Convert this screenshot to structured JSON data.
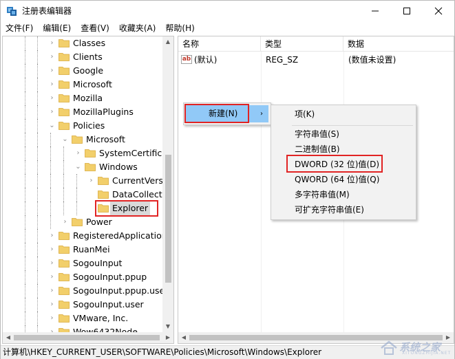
{
  "window": {
    "title": "注册表编辑器"
  },
  "menu": [
    {
      "label": "文件(F)"
    },
    {
      "label": "编辑(E)"
    },
    {
      "label": "查看(V)"
    },
    {
      "label": "收藏夹(A)"
    },
    {
      "label": "帮助(H)"
    }
  ],
  "tree": {
    "items": [
      {
        "label": "Classes",
        "level": 0,
        "expanded": false
      },
      {
        "label": "Clients",
        "level": 0,
        "expanded": false
      },
      {
        "label": "Google",
        "level": 0,
        "expanded": false
      },
      {
        "label": "Microsoft",
        "level": 0,
        "expanded": false
      },
      {
        "label": "Mozilla",
        "level": 0,
        "expanded": false
      },
      {
        "label": "MozillaPlugins",
        "level": 0,
        "expanded": false
      },
      {
        "label": "Policies",
        "level": 0,
        "expanded": true
      },
      {
        "label": "Microsoft",
        "level": 1,
        "expanded": true
      },
      {
        "label": "SystemCertificat",
        "level": 2,
        "expanded": false
      },
      {
        "label": "Windows",
        "level": 2,
        "expanded": true
      },
      {
        "label": "CurrentVersi",
        "level": 3,
        "expanded": false
      },
      {
        "label": "DataCollectio",
        "level": 3,
        "expanded": null
      },
      {
        "label": "Explorer",
        "level": 3,
        "expanded": null,
        "selected": true
      },
      {
        "label": "Power",
        "level": 1,
        "expanded": false
      },
      {
        "label": "RegisteredApplications",
        "level": 0,
        "expanded": false
      },
      {
        "label": "RuanMei",
        "level": 0,
        "expanded": false
      },
      {
        "label": "SogouInput",
        "level": 0,
        "expanded": false
      },
      {
        "label": "SogouInput.ppup",
        "level": 0,
        "expanded": false
      },
      {
        "label": "SogouInput.ppup.user",
        "level": 0,
        "expanded": false
      },
      {
        "label": "SogouInput.user",
        "level": 0,
        "expanded": false
      },
      {
        "label": "VMware, Inc.",
        "level": 0,
        "expanded": false
      },
      {
        "label": "Wow6432Node",
        "level": 0,
        "expanded": false
      }
    ]
  },
  "list": {
    "columns": [
      "名称",
      "类型",
      "数据"
    ],
    "rows": [
      {
        "name": "(默认)",
        "type": "REG_SZ",
        "data": "(数值未设置)",
        "icon": "string-value-icon"
      }
    ]
  },
  "context_menu": {
    "new_label": "新建(N)",
    "arrow": "›"
  },
  "submenu": {
    "items": [
      {
        "label": "项(K)"
      },
      {
        "label": "字符串值(S)"
      },
      {
        "label": "二进制值(B)"
      },
      {
        "label": "DWORD (32 位)值(D)"
      },
      {
        "label": "QWORD (64 位)值(Q)"
      },
      {
        "label": "多字符串值(M)"
      },
      {
        "label": "可扩充字符串值(E)"
      }
    ]
  },
  "statusbar": {
    "path": "计算机\\HKEY_CURRENT_USER\\SOFTWARE\\Policies\\Microsoft\\Windows\\Explorer"
  },
  "watermark": {
    "text": "系统之家",
    "sub": "XITONGZHIJIA.NET"
  },
  "colors": {
    "highlight_border": "#e12323",
    "menu_hover": "#91c9f7",
    "folder": "#f2cf6b",
    "selected_row": "#d9d9d9"
  }
}
